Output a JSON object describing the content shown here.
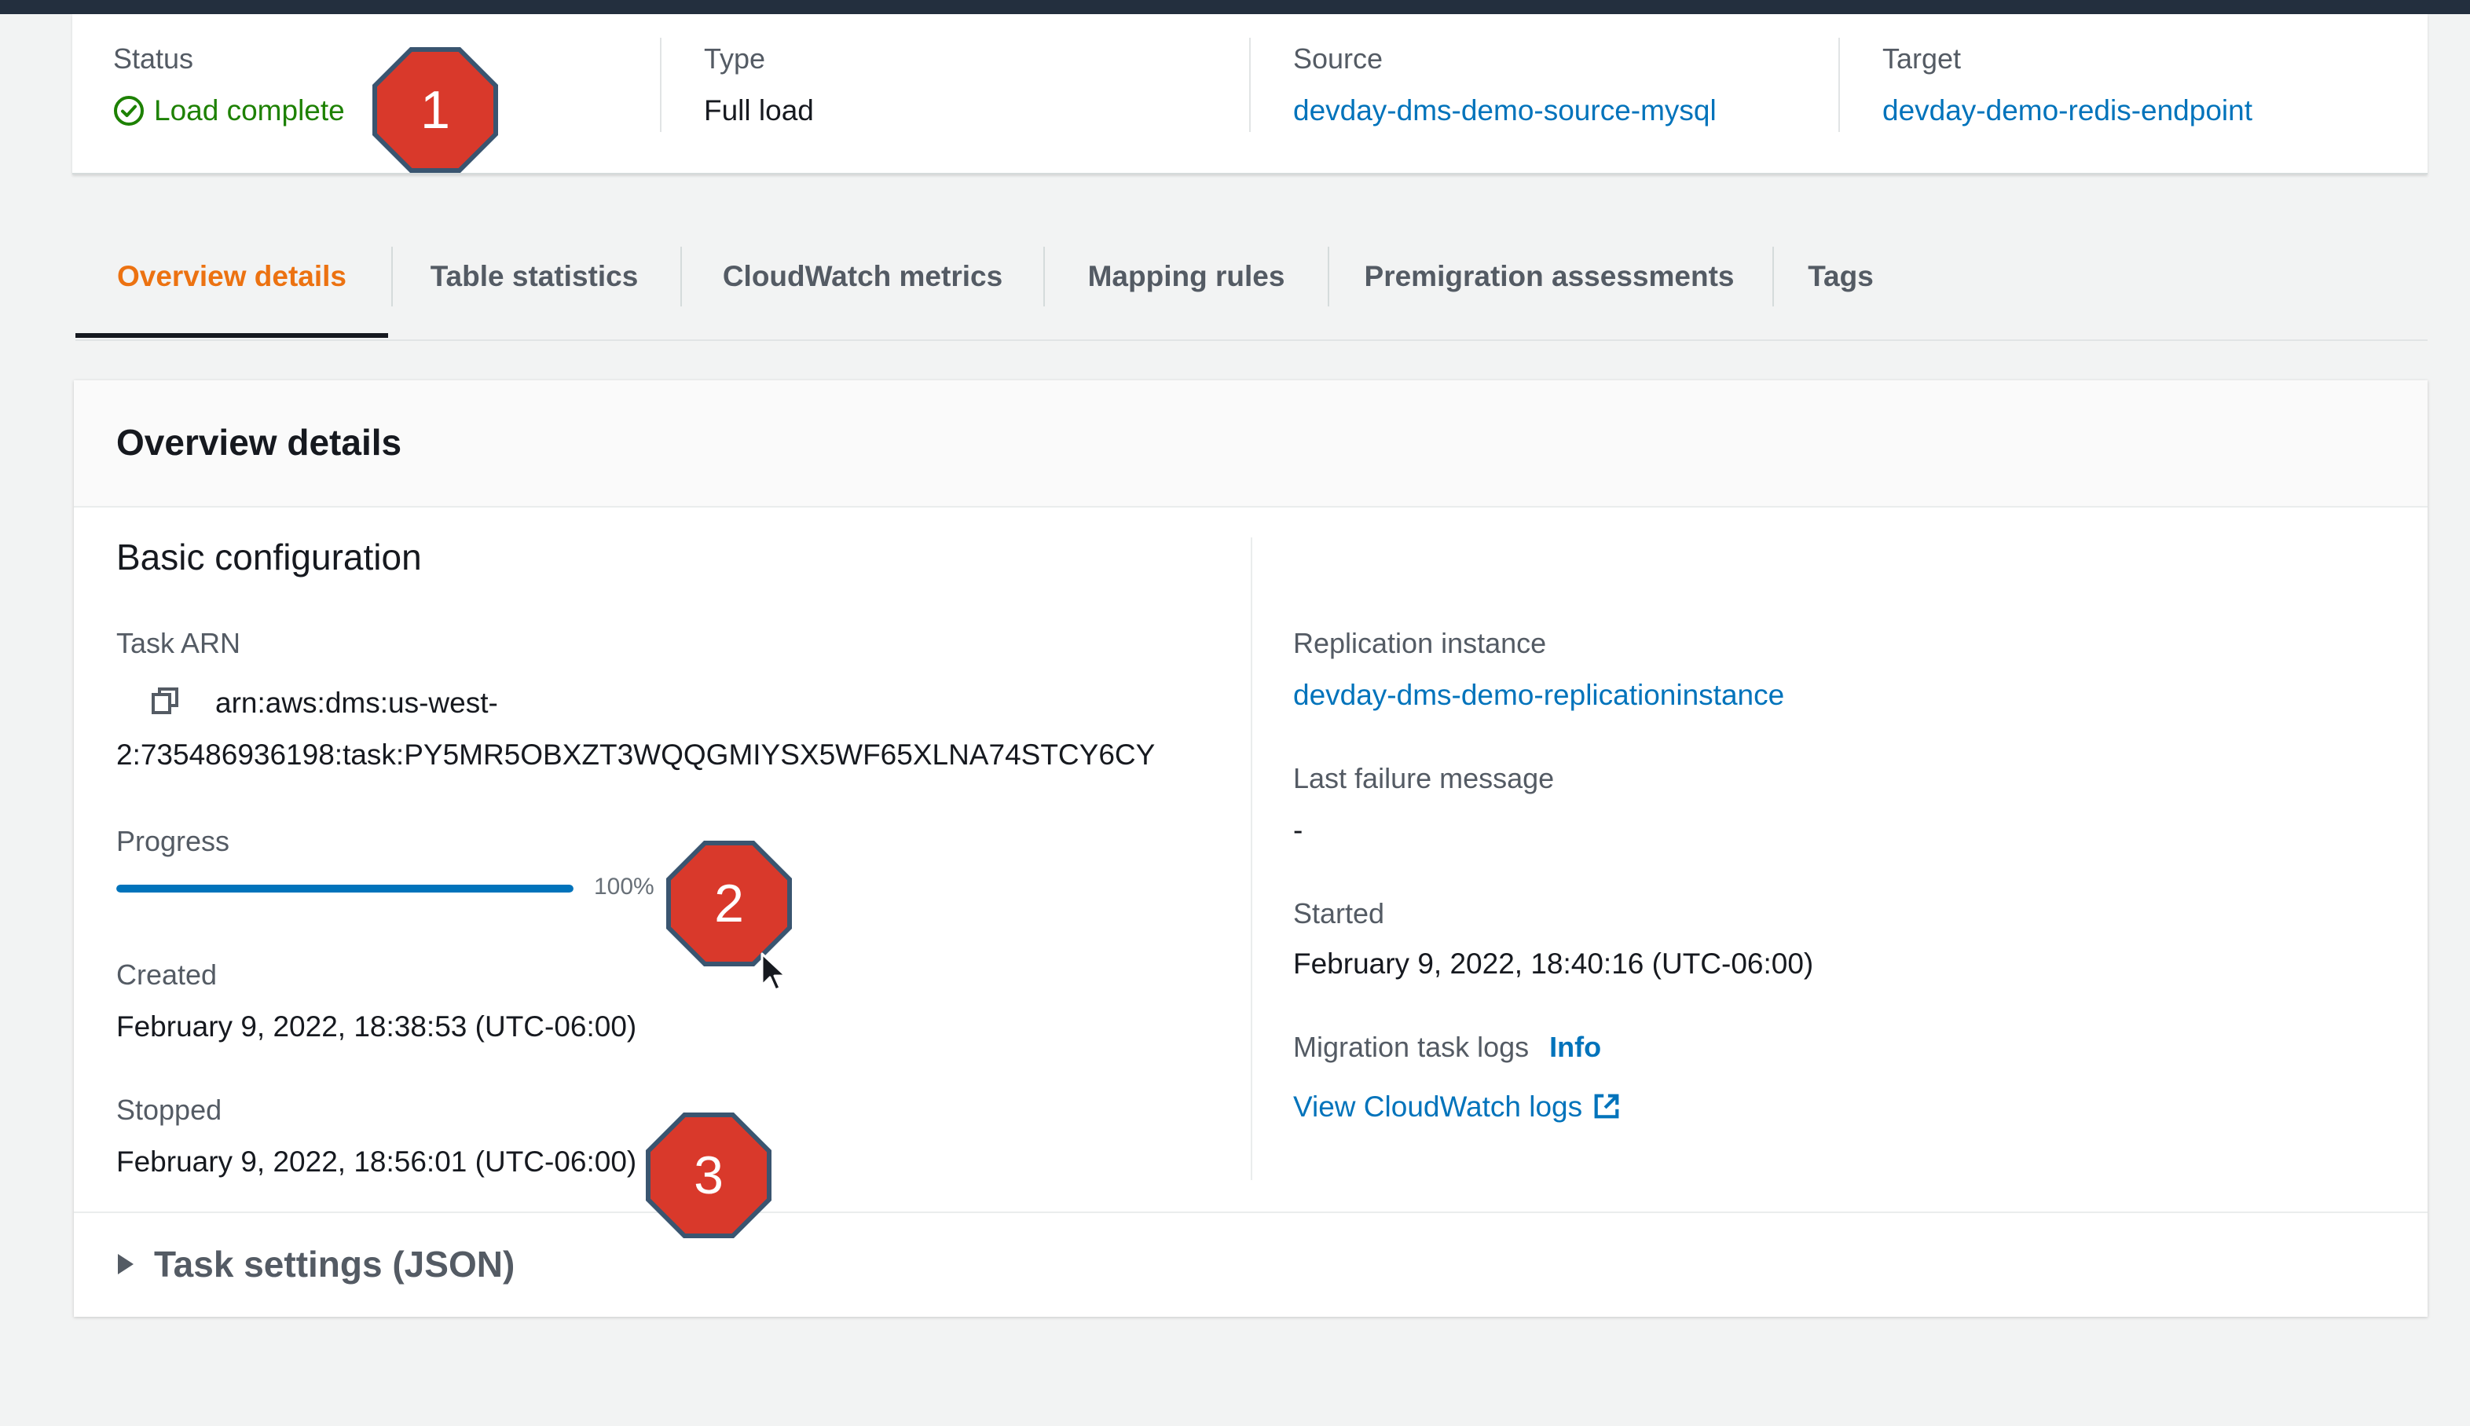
{
  "summary": {
    "status_label": "Status",
    "status_value": "Load complete",
    "type_label": "Type",
    "type_value": "Full load",
    "source_label": "Source",
    "source_value": "devday-dms-demo-source-mysql",
    "target_label": "Target",
    "target_value": "devday-demo-redis-endpoint"
  },
  "tabs": [
    {
      "label": "Overview details",
      "active": true
    },
    {
      "label": "Table statistics"
    },
    {
      "label": "CloudWatch metrics"
    },
    {
      "label": "Mapping rules"
    },
    {
      "label": "Premigration assessments"
    },
    {
      "label": "Tags"
    }
  ],
  "overview": {
    "title": "Overview details",
    "section_title": "Basic configuration",
    "task_arn_label": "Task ARN",
    "task_arn_line1": "arn:aws:dms:us-west-",
    "task_arn_line2": "2:735486936198:task:PY5MR5OBXZT3WQQGMIYSX5WF65XLNA74STCY6CY",
    "progress_label": "Progress",
    "progress_value": 1.0,
    "progress_text": "100%",
    "created_label": "Created",
    "created_value": "February 9, 2022, 18:38:53 (UTC-06:00)",
    "stopped_label": "Stopped",
    "stopped_value": "February 9, 2022, 18:56:01 (UTC-06:00)",
    "replication_label": "Replication instance",
    "replication_value": "devday-dms-demo-replicationinstance",
    "failure_label": "Last failure message",
    "failure_value": "-",
    "started_label": "Started",
    "started_value": "February 9, 2022, 18:40:16 (UTC-06:00)",
    "logs_label": "Migration task logs",
    "logs_info": "Info",
    "logs_link": "View CloudWatch logs",
    "task_settings_label": "Task settings (JSON)"
  },
  "callouts": [
    "1",
    "2",
    "3"
  ],
  "colors": {
    "accent_orange": "#ec7211",
    "link_blue": "#0073bb",
    "success_green": "#1d8102",
    "callout_red": "#d9392b"
  },
  "icons": {
    "status": "check-circle-icon",
    "copy": "copy-icon",
    "external": "external-link-icon",
    "expander": "caret-right-icon"
  }
}
